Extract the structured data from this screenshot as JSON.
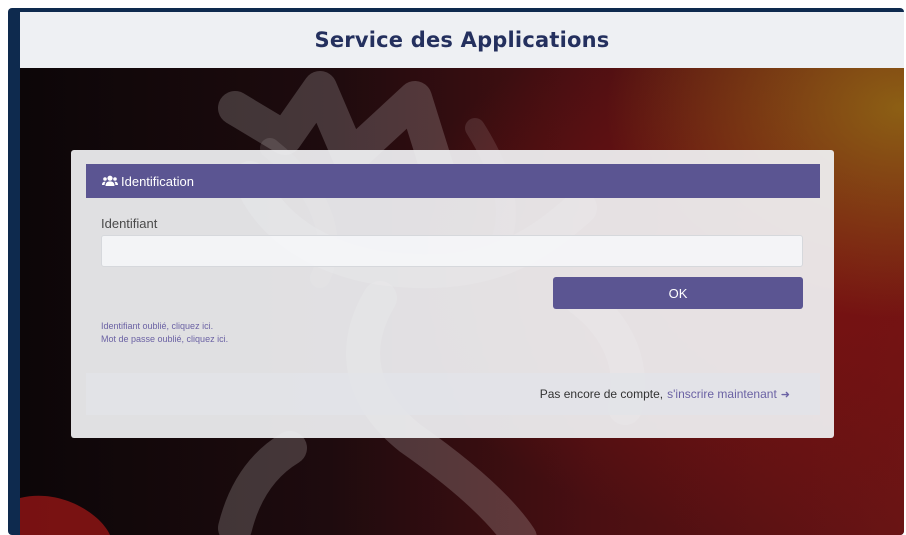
{
  "app": {
    "title": "Service des Applications"
  },
  "login_panel": {
    "heading": "Identification",
    "heading_icon": "users-icon",
    "field_label": "Identifiant",
    "field_value": "",
    "submit_label": "OK",
    "forgot_identifier_link": "Identifiant oublié, cliquez ici.",
    "forgot_password_link": "Mot de passe oublié, cliquez ici.",
    "signup_prompt": "Pas encore de compte,",
    "signup_link": "s'inscrire maintenant",
    "signup_icon": "sign-in-icon"
  },
  "colors": {
    "accent": "#5b5592",
    "link": "#6b62a4",
    "title": "#24305e",
    "frame": "#0e2a4e"
  }
}
